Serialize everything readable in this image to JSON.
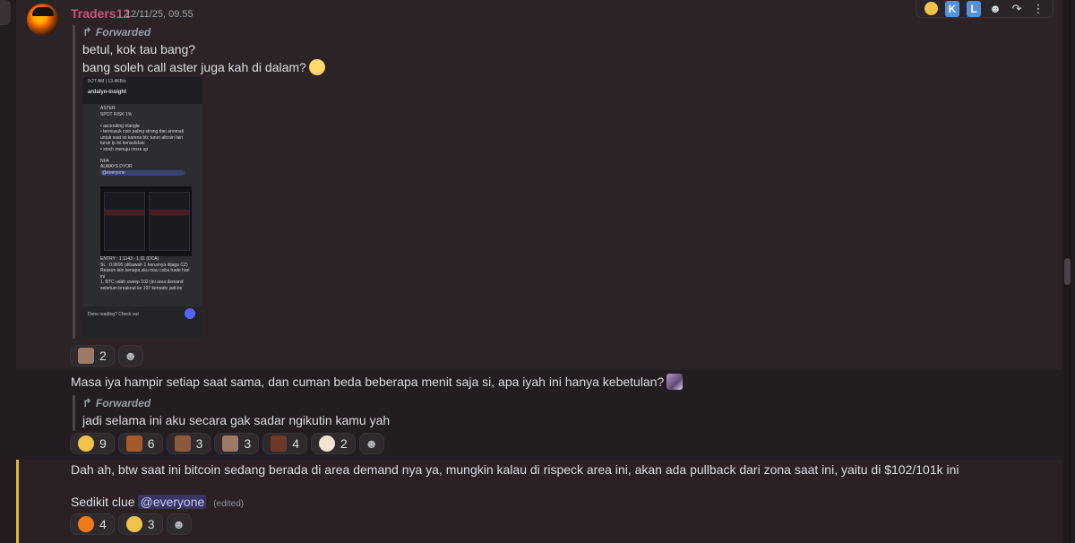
{
  "message": {
    "username": "Traders12",
    "timestamp": "12/11/25, 09.55",
    "forward1_label": "Forwarded",
    "forward1_line1": "betul, kok tau bang?",
    "forward1_line2": "bang soleh call aster juga kah di dalam?",
    "image": {
      "status": "9:27 AM | 13.4KB/s",
      "channel": "ardalyn-insight",
      "lines": [
        "ASTER",
        "SPOT RISK 1%",
        "",
        "• ascending triangle",
        "• termasuk coin paling strong dan anomali",
        "  untuk saat ini karena btc turun altcoin lain",
        "  turun tp ini konsolidasi",
        "• stoch menuju cross up",
        "",
        "NFA",
        "ALWAYS DYOR",
        "@everyone"
      ],
      "lower_lines": [
        "ENTRY : 1.1143 - 1.01 (DCA)",
        "SL : 0.9695 (dibawah 1 harusnya dijaga CZ)",
        "Reason lain kenapa aku mau coba trade hari",
        "ini",
        "1.  BTC udah sweep 102 (ini area demand",
        "    sebelum breakout ke 107 kemarin jadi bs"
      ],
      "footer": "Done reading? Check out"
    },
    "reactions1": [
      {
        "emoji": "portrait",
        "count": "2"
      }
    ],
    "line_masa": "Masa iya hampir setiap saat sama, dan cuman beda beberapa menit saja si, apa iyah ini hanya kebetulan?",
    "forward2_label": "Forwarded",
    "forward2_line": "jadi selama ini aku secara gak sadar ngikutin kamu yah",
    "reactions2": [
      {
        "emoji": "smile",
        "count": "9",
        "color": "#f1c34a"
      },
      {
        "emoji": "squirrel",
        "count": "6",
        "color": "#a45a2a"
      },
      {
        "emoji": "hand",
        "count": "3",
        "color": "#8b5a3c"
      },
      {
        "emoji": "portrait",
        "count": "3",
        "color": "#9b7a6a"
      },
      {
        "emoji": "screen",
        "count": "4",
        "color": "#6b3a2a"
      },
      {
        "emoji": "clown",
        "count": "2",
        "color": "#f2e3d5"
      }
    ],
    "line_dah": "Dah ah, btw saat ini bitcoin sedang berada di area demand nya ya, mungkin kalau di rispeck area ini, akan ada pullback dari zona saat ini, yaitu di $102/101k ini",
    "line_sedikit": "Sedikit clue",
    "mention": "@everyone",
    "edited": "(edited)",
    "reactions3": [
      {
        "emoji": "fire",
        "count": "4",
        "color": "#f07a1a"
      },
      {
        "emoji": "monocle",
        "count": "3",
        "color": "#f1c34a"
      }
    ]
  },
  "toolbar": {
    "k_label": "K",
    "l_label": "L"
  }
}
